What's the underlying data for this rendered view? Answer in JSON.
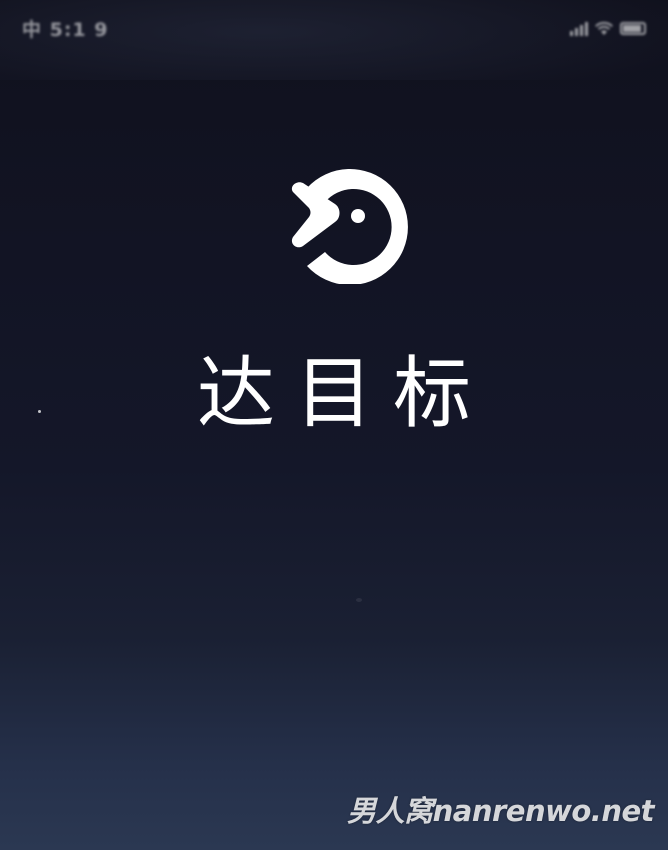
{
  "status_bar": {
    "left_text": "中 5:1 9"
  },
  "splash": {
    "logo_icon": "da-mubiao-logo-icon",
    "app_name": "达目标"
  },
  "watermark": {
    "text": "男人窝nanrenwo.net"
  },
  "colors": {
    "background_top": "#10111d",
    "background_bottom": "#2b3852",
    "foreground": "#ffffff"
  }
}
